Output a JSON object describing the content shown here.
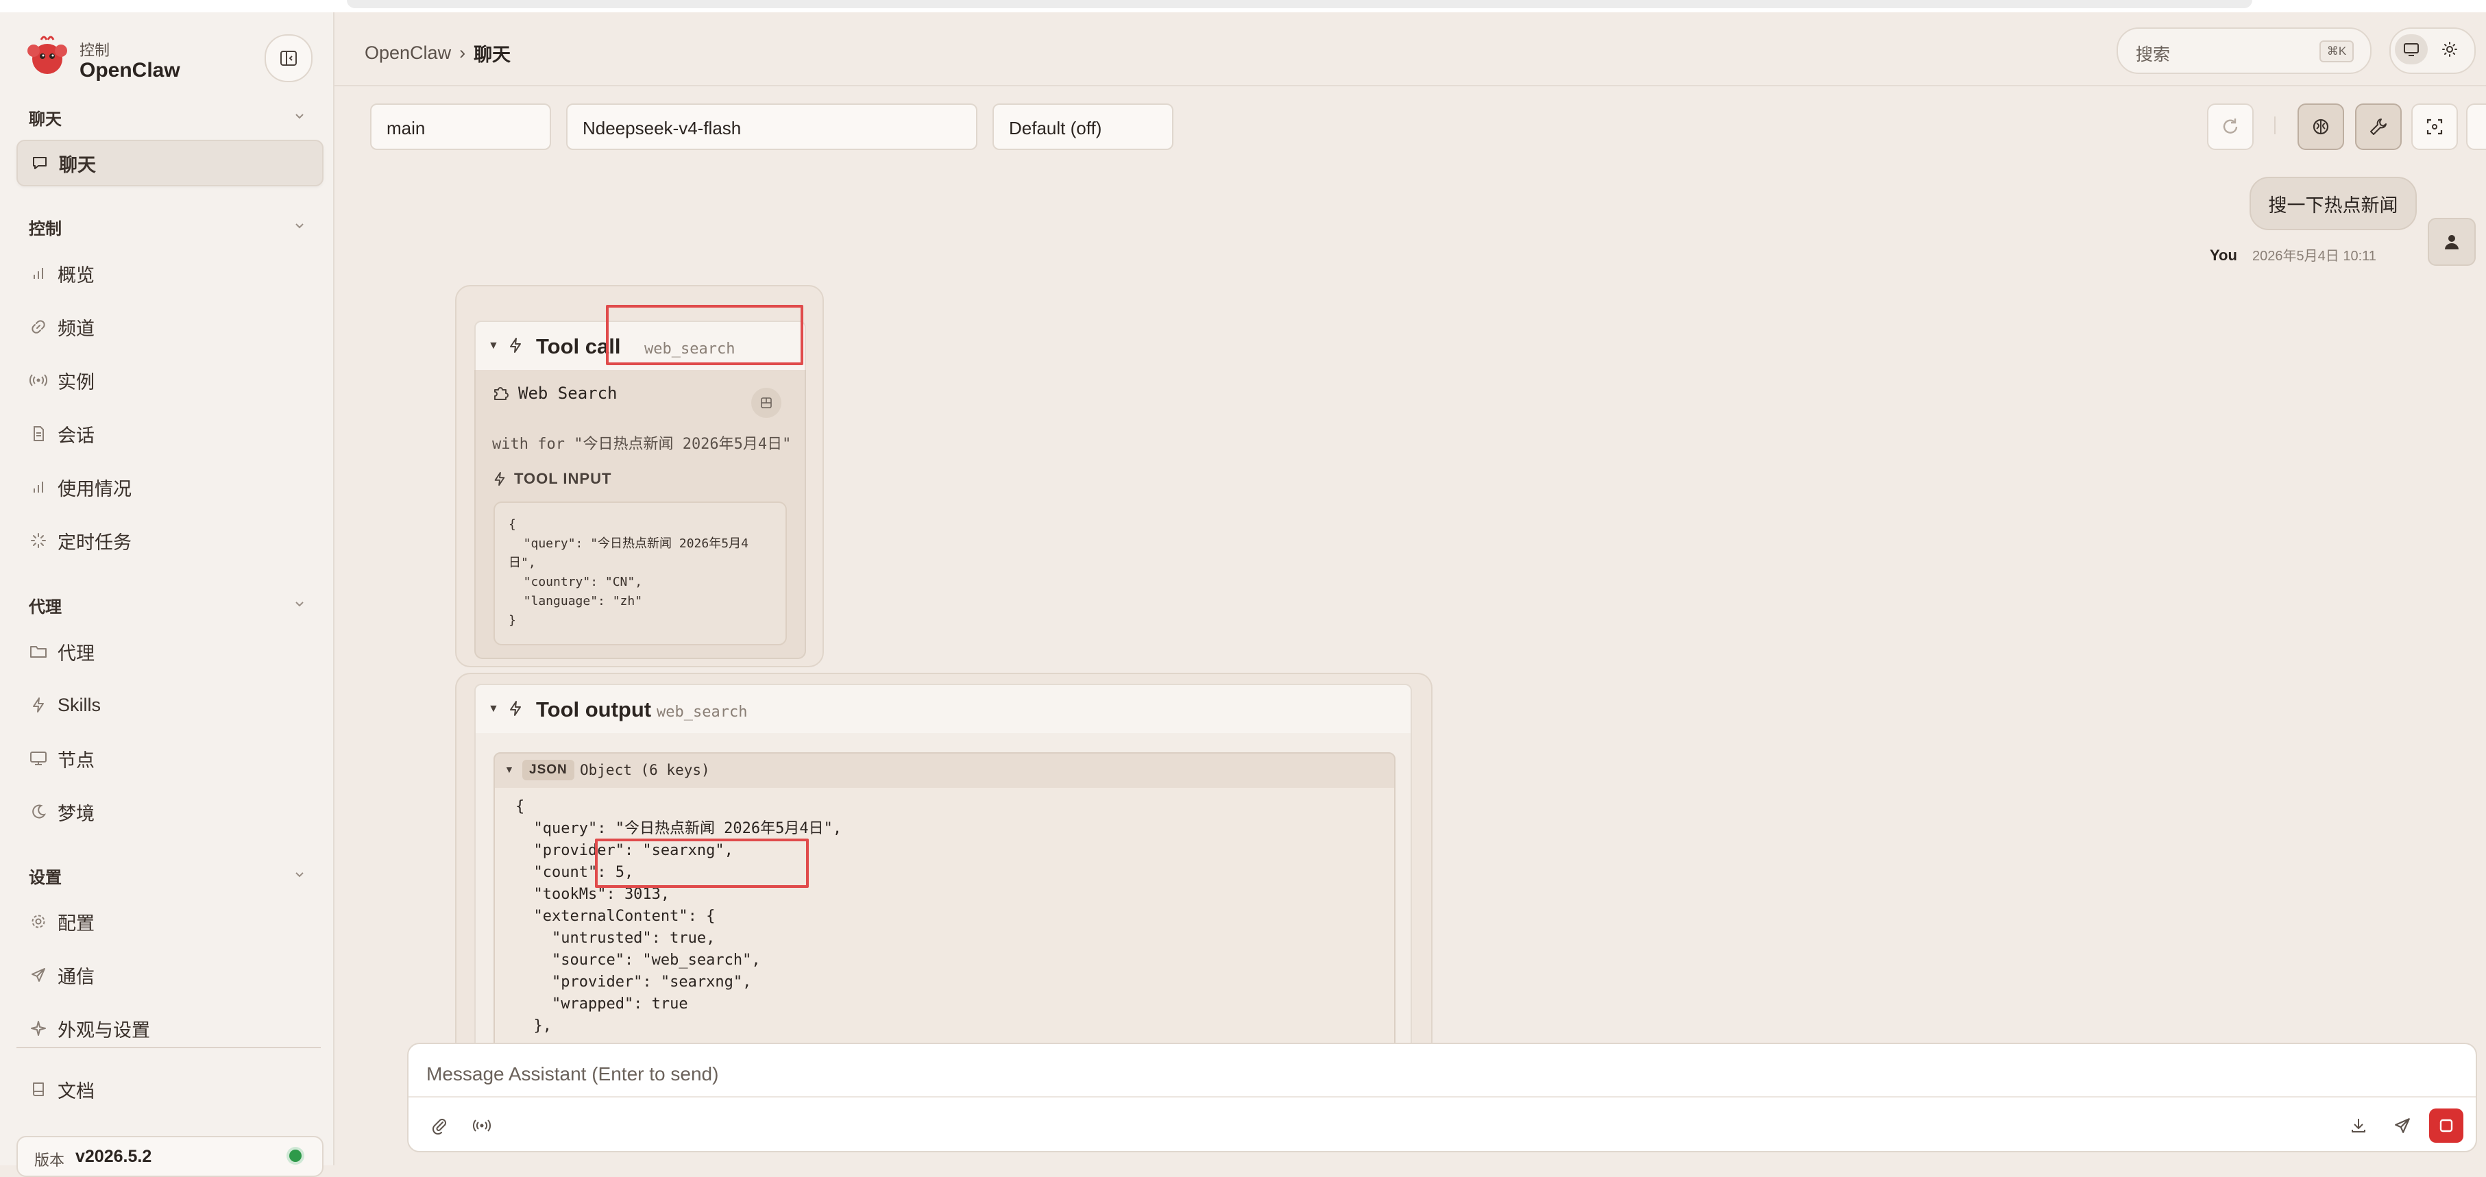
{
  "brand": {
    "sub": "控制",
    "name": "OpenClaw"
  },
  "sidebar": {
    "sections": [
      {
        "title": "聊天",
        "items": [
          {
            "label": "聊天",
            "icon": "chat-bubble-icon",
            "active": true
          }
        ]
      },
      {
        "title": "控制",
        "items": [
          {
            "label": "概览",
            "icon": "bar-chart-icon"
          },
          {
            "label": "频道",
            "icon": "link-icon"
          },
          {
            "label": "实例",
            "icon": "broadcast-icon"
          },
          {
            "label": "会话",
            "icon": "document-icon"
          },
          {
            "label": "使用情况",
            "icon": "bar-chart-icon"
          },
          {
            "label": "定时任务",
            "icon": "loader-icon"
          }
        ]
      },
      {
        "title": "代理",
        "items": [
          {
            "label": "代理",
            "icon": "folder-icon"
          },
          {
            "label": "Skills",
            "icon": "bolt-icon"
          },
          {
            "label": "节点",
            "icon": "monitor-icon"
          },
          {
            "label": "梦境",
            "icon": "moon-icon"
          }
        ]
      },
      {
        "title": "设置",
        "items": [
          {
            "label": "配置",
            "icon": "gear-icon"
          },
          {
            "label": "通信",
            "icon": "send-icon"
          },
          {
            "label": "外观与设置",
            "icon": "sparkle-icon"
          }
        ]
      }
    ],
    "docs": {
      "label": "文档",
      "icon": "book-icon"
    },
    "version": {
      "label": "版本",
      "value": "v2026.5.2",
      "status_color": "#2e9a4a"
    }
  },
  "header": {
    "breadcrumb": [
      "OpenClaw",
      "聊天"
    ],
    "search": {
      "placeholder": "搜索",
      "shortcut": "⌘K"
    }
  },
  "controls": {
    "session": "main",
    "model": "Ndeepseek-v4-flash",
    "thinking": "Default (off)"
  },
  "messages": {
    "user": {
      "text": "搜一下热点新闻",
      "author": "You",
      "timestamp": "2026年5月4日 10:11"
    }
  },
  "tool_call": {
    "title": "Tool call",
    "name": "web_search",
    "tool_label": "Web Search",
    "summary": "with for \"今日热点新闻 2026年5月4日\"",
    "input_label": "TOOL INPUT",
    "input_code": "{\n  \"query\": \"今日热点新闻 2026年5月4\n日\",\n  \"country\": \"CN\",\n  \"language\": \"zh\"\n}"
  },
  "tool_output": {
    "title": "Tool output",
    "name": "web_search",
    "json_tag": "JSON",
    "json_desc": "Object (6 keys)",
    "json_code": "{\n  \"query\": \"今日热点新闻 2026年5月4日\",\n  \"provider\": \"searxng\",\n  \"count\": 5,\n  \"tookMs\": 3013,\n  \"externalContent\": {\n    \"untrusted\": true,\n    \"source\": \"web_search\",\n    \"provider\": \"searxng\",\n    \"wrapped\": true\n  },"
  },
  "composer": {
    "placeholder": "Message Assistant (Enter to send)"
  },
  "colors": {
    "accent": "#d93030",
    "highlight": "#e04b4b",
    "background": "#f2ebe5"
  }
}
